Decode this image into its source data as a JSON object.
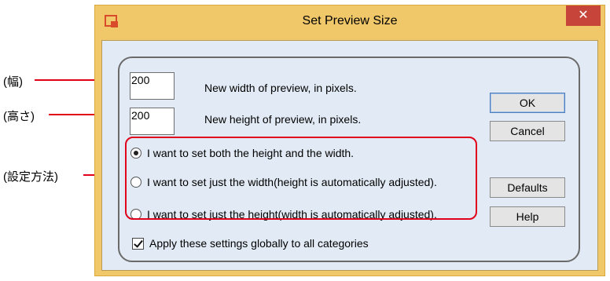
{
  "window": {
    "title": "Set Preview Size",
    "close_glyph": "✕",
    "icon": "app-icon"
  },
  "fields": {
    "width": {
      "value": "200",
      "description": "New width of preview, in pixels."
    },
    "height": {
      "value": "200",
      "description": "New height of preview, in pixels."
    }
  },
  "buttons": {
    "ok": "OK",
    "cancel": "Cancel",
    "defaults": "Defaults",
    "help": "Help"
  },
  "radios": [
    {
      "label": "I want to set both the height and the width.",
      "checked": true
    },
    {
      "label": "I want to set just the width(height is automatically adjusted).",
      "checked": false
    },
    {
      "label": "I want to set just the height(width is automatically adjusted).",
      "checked": false
    }
  ],
  "checkbox": {
    "label": "Apply these settings globally to all categories",
    "checked": true
  },
  "annotations": {
    "width": "(幅)",
    "height": "(高さ)",
    "method": "(設定方法)"
  },
  "colors": {
    "highlight": "#e0001b",
    "frame": "#f0c86a",
    "client": "#e2ebf5",
    "close": "#c7443b"
  }
}
